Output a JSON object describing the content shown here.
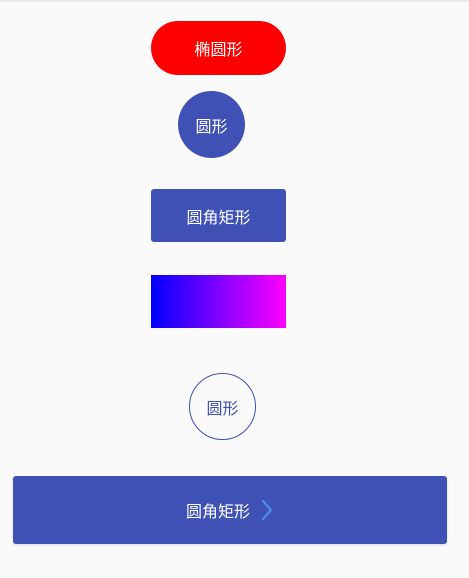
{
  "shapes": {
    "ellipse_label": "椭圆形",
    "circle_label": "圆形",
    "rounded_rect_label": "圆角矩形",
    "outline_circle_label": "圆形",
    "wide_button_label": "圆角矩形"
  },
  "colors": {
    "ellipse": "#ff0000",
    "primary": "#3f51b5",
    "gradient_start": "#0000ff",
    "gradient_end": "#ff00ff",
    "chevron": "#4a8ff0",
    "background": "#fafafa"
  },
  "icons": {
    "wide_button_icon": "chevron-right-icon"
  }
}
